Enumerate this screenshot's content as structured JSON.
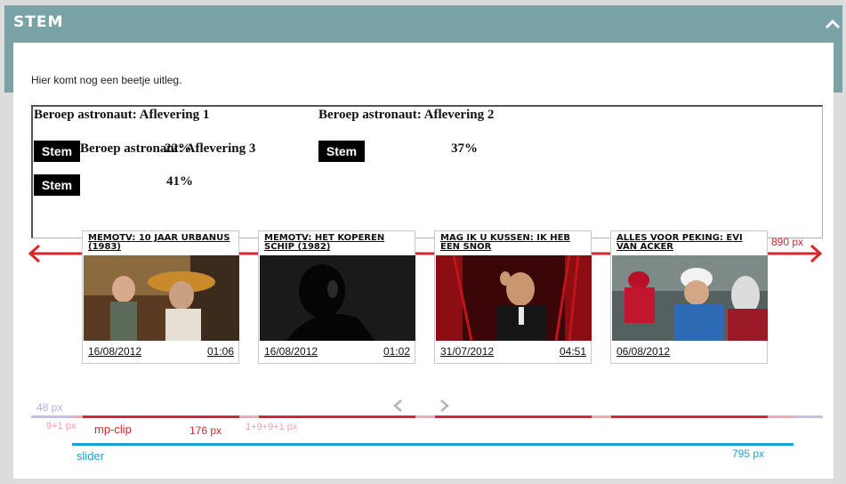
{
  "header": {
    "title": "STEM"
  },
  "intro_text": "Hier komt nog een beetje uitleg.",
  "poll": {
    "episodes": [
      {
        "title": "Beroep astronaut: Aflevering 1",
        "button": "Stem",
        "percent": "22%"
      },
      {
        "title": "Beroep astronaut: Aflevering 2",
        "button": "Stem",
        "percent": "37%"
      },
      {
        "title": "Beroep astronaut: Aflevering 3",
        "button": "Stem",
        "percent": "41%"
      }
    ]
  },
  "annotations": {
    "width_890": "890 px",
    "height_48": "48 px",
    "margin_9_1": "9+1 px",
    "mp_clip": "mp-clip",
    "clip_width": "176 px",
    "gap": "1+9+9+1 px",
    "slider": "slider",
    "slider_width": "795 px"
  },
  "clips": [
    {
      "title": "MEMOTV: 10 JAAR URBANUS (1983)",
      "date": "16/08/2012",
      "duration": "01:06"
    },
    {
      "title": "MEMOTV: HET KOPEREN SCHIP (1982)",
      "date": "16/08/2012",
      "duration": "01:02"
    },
    {
      "title": "MAG IK U KUSSEN: IK HEB EEN SNOR",
      "date": "31/07/2012",
      "duration": "04:51"
    },
    {
      "title": "ALLES VOOR PEKING: EVI VAN ACKER",
      "date": "06/08/2012",
      "duration": ""
    }
  ],
  "colors": {
    "header": "#7aa3a8",
    "annotation_red": "#d9262e",
    "annotation_pink": "#f4a7b9",
    "annotation_lavender": "#c9bde0",
    "slider_blue": "#1aa0d8"
  },
  "icons": {
    "collapse": "chevron-up-icon",
    "prev": "chevron-left-icon",
    "next": "chevron-right-icon"
  }
}
